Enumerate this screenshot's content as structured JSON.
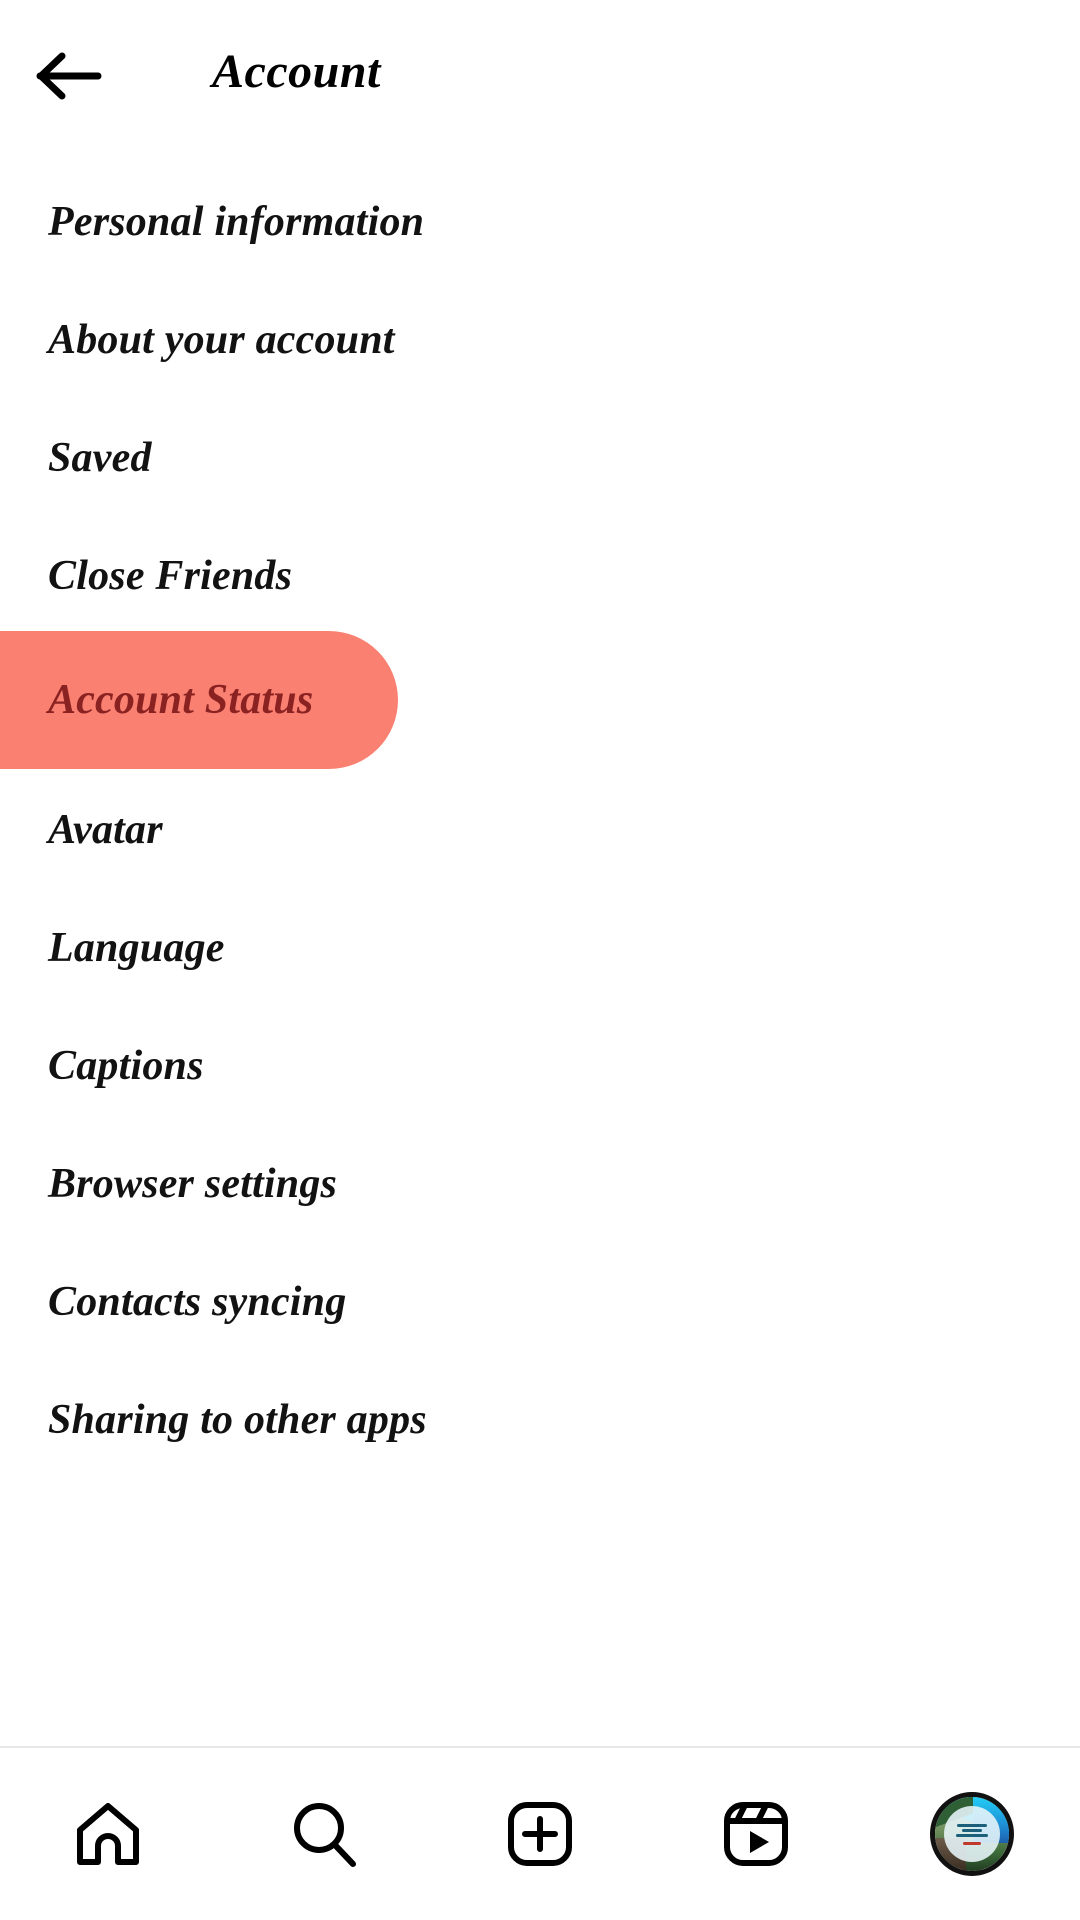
{
  "header": {
    "back_icon": "arrow-left-icon",
    "title": "Account"
  },
  "menu": {
    "items": [
      {
        "label": "Personal information",
        "highlighted": false
      },
      {
        "label": "About your account",
        "highlighted": false
      },
      {
        "label": "Saved",
        "highlighted": false
      },
      {
        "label": "Close Friends",
        "highlighted": false
      },
      {
        "label": "Account Status",
        "highlighted": true
      },
      {
        "label": "Avatar",
        "highlighted": false
      },
      {
        "label": "Language",
        "highlighted": false
      },
      {
        "label": "Captions",
        "highlighted": false
      },
      {
        "label": "Browser settings",
        "highlighted": false
      },
      {
        "label": "Contacts syncing",
        "highlighted": false
      },
      {
        "label": "Sharing to other apps",
        "highlighted": false
      }
    ]
  },
  "highlight": {
    "background_color": "#FA8072",
    "text_color": "#8B2222"
  },
  "bottom_nav": {
    "items": [
      {
        "icon": "home-icon",
        "name": "home"
      },
      {
        "icon": "search-icon",
        "name": "search"
      },
      {
        "icon": "plus-square-icon",
        "name": "create"
      },
      {
        "icon": "reels-icon",
        "name": "reels"
      },
      {
        "icon": "profile-avatar",
        "name": "profile"
      }
    ]
  }
}
